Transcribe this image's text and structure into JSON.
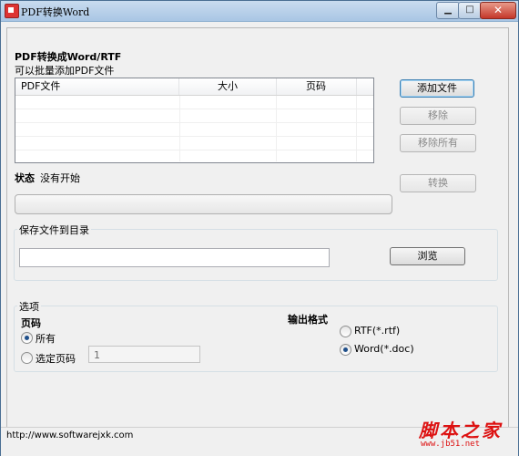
{
  "window": {
    "title": "PDF转换Word"
  },
  "source": {
    "heading": "PDF转换成Word/RTF",
    "hint": "可以批量添加PDF文件",
    "columns": [
      "PDF文件",
      "大小",
      "页码"
    ],
    "add_label": "添加文件",
    "remove_label": "移除",
    "remove_all_label": "移除所有"
  },
  "status": {
    "label": "状态",
    "value": "没有开始",
    "convert_label": "转换",
    "progress": 0
  },
  "save": {
    "group_title": "保存文件到目录",
    "path": "",
    "browse_label": "浏览"
  },
  "options": {
    "group_title": "选项",
    "pages_heading": "页码",
    "all_label": "所有",
    "selected_label": "选定页码",
    "page_value": "1",
    "format_heading": "输出格式",
    "rtf_label": "RTF(*.rtf)",
    "doc_label": "Word(*.doc)"
  },
  "footer": {
    "url": "http://www.softwarejxk.com"
  },
  "watermark": {
    "main": "脚本之家",
    "url": "www.jb51.net"
  }
}
